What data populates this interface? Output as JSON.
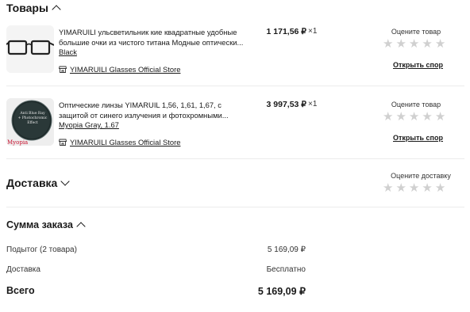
{
  "goods": {
    "heading": "Товары",
    "items": [
      {
        "title": "YIMARUILI ульсветильник кие квадратные удобные большие очки из чистого титана Модные оптически...",
        "variant": "Black",
        "store": "YIMARUILI Glasses Official Store",
        "price": "1 171,56 ₽",
        "qty": "×1",
        "rate_label": "Оцените товар",
        "dispute": "Открыть спор"
      },
      {
        "title": "Оптические линзы YIMARUIL 1,56, 1,61, 1,67, с защитой от синего излучения и фотохромными...",
        "variant": "Myopia Gray, 1.67",
        "store": "YIMARUILI Glasses Official Store",
        "price": "3 997,53 ₽",
        "qty": "×1",
        "rate_label": "Оцените товар",
        "dispute": "Открыть спор",
        "thumb_lines": [
          "Anti Blue Ray",
          "+ Photochromic",
          "Effect"
        ],
        "thumb_caption": "Myopia"
      }
    ]
  },
  "delivery": {
    "heading": "Доставка",
    "rate_label": "Оцените доставку"
  },
  "summary": {
    "heading": "Сумма заказа",
    "subtotal_label": "Подытог (2 товара)",
    "subtotal_value": "5 169,09 ₽",
    "shipping_label": "Доставка",
    "shipping_value": "Бесплатно",
    "total_label": "Всего",
    "total_value": "5 169,09 ₽"
  },
  "colors": {
    "star_empty": "#d0d0d0",
    "divider": "#ececec",
    "caption_red": "#c8102e"
  },
  "star_rating": {
    "max": 5,
    "filled": 0
  }
}
